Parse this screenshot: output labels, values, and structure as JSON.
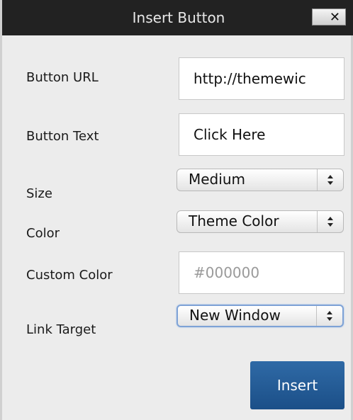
{
  "dialog": {
    "title": "Insert Button",
    "close_label": "✕"
  },
  "form": {
    "button_url": {
      "label": "Button URL",
      "value": "http://themewic"
    },
    "button_text": {
      "label": "Button Text",
      "value": "Click Here"
    },
    "size": {
      "label": "Size",
      "selected": "Medium"
    },
    "color": {
      "label": "Color",
      "selected": "Theme Color"
    },
    "custom_color": {
      "label": "Custom Color",
      "placeholder": "#000000"
    },
    "link_target": {
      "label": "Link Target",
      "selected": "New Window"
    }
  },
  "actions": {
    "insert_label": "Insert"
  },
  "colors": {
    "titlebar": "#222222",
    "insert_button": "#1f5690",
    "focus_ring": "#7ea2d6"
  },
  "icons": {
    "close": "close-icon",
    "select_arrows": "updown-arrows-icon"
  }
}
